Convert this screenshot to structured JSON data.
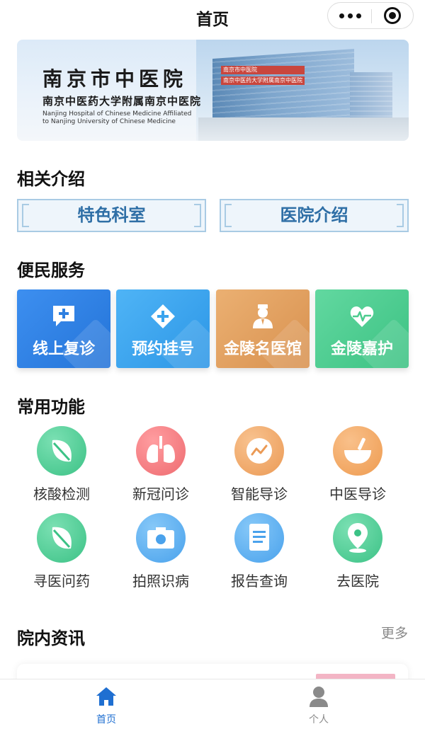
{
  "topbar": {
    "title": "首页"
  },
  "banner": {
    "name_main": "南京市中医院",
    "name_sub": "南京中医药大学附属南京中医院",
    "name_en_1": "Nanjing Hospital of Chinese Medicine Affiliated",
    "name_en_2": "to Nanjing University of Chinese Medicine",
    "sign_1": "南京市中医院",
    "sign_2": "南京中医药大学附属南京中医院"
  },
  "intro": {
    "title": "相关介绍",
    "buttons": [
      "特色科室",
      "医院介绍"
    ]
  },
  "services": {
    "title": "便民服务",
    "cards": [
      {
        "label": "线上复诊",
        "icon": "chat-plus-icon",
        "color": "#2e7fe0"
      },
      {
        "label": "预约挂号",
        "icon": "diamond-cross-icon",
        "color": "#3aa4ee"
      },
      {
        "label": "金陵名医馆",
        "icon": "doctor-icon",
        "color": "#e3a05e"
      },
      {
        "label": "金陵嘉护",
        "icon": "heartbeat-icon",
        "color": "#4dcc8f"
      }
    ]
  },
  "functions": {
    "title": "常用功能",
    "items": [
      {
        "label": "核酸检测",
        "icon": "leaf-icon",
        "color": "#4ccf95"
      },
      {
        "label": "新冠问诊",
        "icon": "lungs-icon",
        "color": "#f27d80"
      },
      {
        "label": "智能导诊",
        "icon": "chart-line-icon",
        "color": "#f1ab6c"
      },
      {
        "label": "中医导诊",
        "icon": "mortar-bowl-icon",
        "color": "#f2a966"
      },
      {
        "label": "寻医问药",
        "icon": "leaf-icon",
        "color": "#4ccf95"
      },
      {
        "label": "拍照识病",
        "icon": "camera-icon",
        "color": "#5aaef0"
      },
      {
        "label": "报告查询",
        "icon": "document-icon",
        "color": "#5aaef0"
      },
      {
        "label": "去医院",
        "icon": "location-pin-icon",
        "color": "#4ccf95"
      }
    ]
  },
  "news": {
    "title": "院内资讯",
    "more": "更多"
  },
  "tabbar": {
    "tabs": [
      {
        "label": "首页",
        "icon": "home-icon",
        "active": true,
        "color": "#1f6fd1"
      },
      {
        "label": "个人",
        "icon": "user-icon",
        "active": false,
        "color": "#8a8a8a"
      }
    ]
  }
}
